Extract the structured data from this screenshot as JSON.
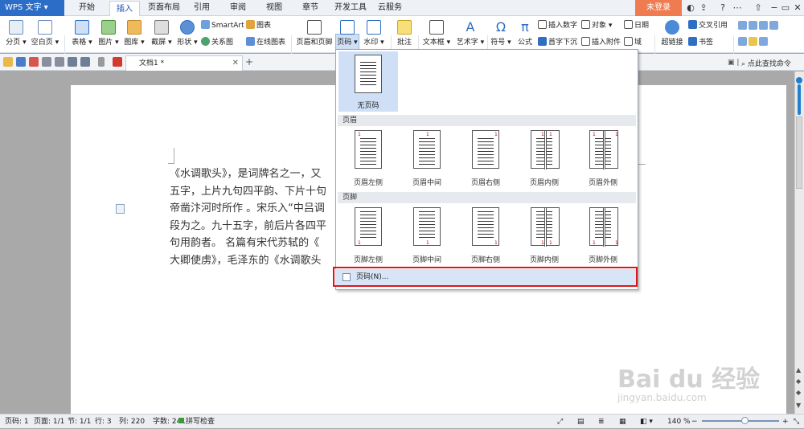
{
  "titlebar": {
    "app_name": "WPS 文字",
    "menus": [
      "开始",
      "插入",
      "页面布局",
      "引用",
      "审阅",
      "视图",
      "章节",
      "开发工具",
      "云服务"
    ],
    "active_menu": "插入",
    "login": "未登录"
  },
  "ribbon": {
    "page_break": "分页",
    "blank_page": "空白页",
    "table": "表格",
    "picture": "图片",
    "gallery": "图库",
    "screenshot": "截屏",
    "shape": "形状",
    "smartart": "SmartArt",
    "chart": "图表",
    "relation": "关系图",
    "online_chart": "在线图表",
    "header_footer": "页眉和页脚",
    "page_number": "页码",
    "watermark": "水印",
    "comment": "批注",
    "textbox": "文本框",
    "wordart": "艺术字",
    "symbol": "符号",
    "formula": "公式",
    "insert_number": "插入数字",
    "object": "对象",
    "date": "日期",
    "drop_cap": "首字下沉",
    "attachment": "插入附件",
    "field": "域",
    "hyperlink": "超链接",
    "crossref": "交叉引用",
    "bookmark": "书签"
  },
  "tabs": {
    "doc_name": "文档1 *",
    "search_cmd": "点此查找命令"
  },
  "document": {
    "lines": [
      "《水调歌头》，是词牌名之一，又",
      "五字，上片九句四平韵、下片十句",
      "帝凿汴河时所作 。宋乐入“中吕调",
      "段为之。九十五字，前后片各四平",
      "句用韵者。 名篇有宋代苏轼的《",
      "大卿使虏》，毛泽东的《水调歌头"
    ]
  },
  "dropdown": {
    "none_label": "无页码",
    "header_section": "页眉",
    "footer_section": "页脚",
    "header_items": [
      "页眉左侧",
      "页眉中间",
      "页眉右侧",
      "页眉内侧",
      "页眉外侧"
    ],
    "footer_items": [
      "页脚左侧",
      "页脚中间",
      "页脚右侧",
      "页脚内侧",
      "页脚外侧"
    ],
    "page_num_option": "页码(N)...",
    "thumb_number": "1"
  },
  "statusbar": {
    "page_no": "页码: 1",
    "pages": "页面: 1/1",
    "section": "节: 1/1",
    "row": "行: 3",
    "col": "列: 220",
    "words": "字数: 241",
    "spell": "拼写检查",
    "zoom": "140 %"
  },
  "watermark": {
    "logo": "Bai du 经验",
    "url": "jingyan.baidu.com"
  },
  "colors": {
    "accent": "#2b6dc7",
    "login": "#ef7b51",
    "highlight": "#e0141b",
    "hover": "#d7e5f6"
  }
}
